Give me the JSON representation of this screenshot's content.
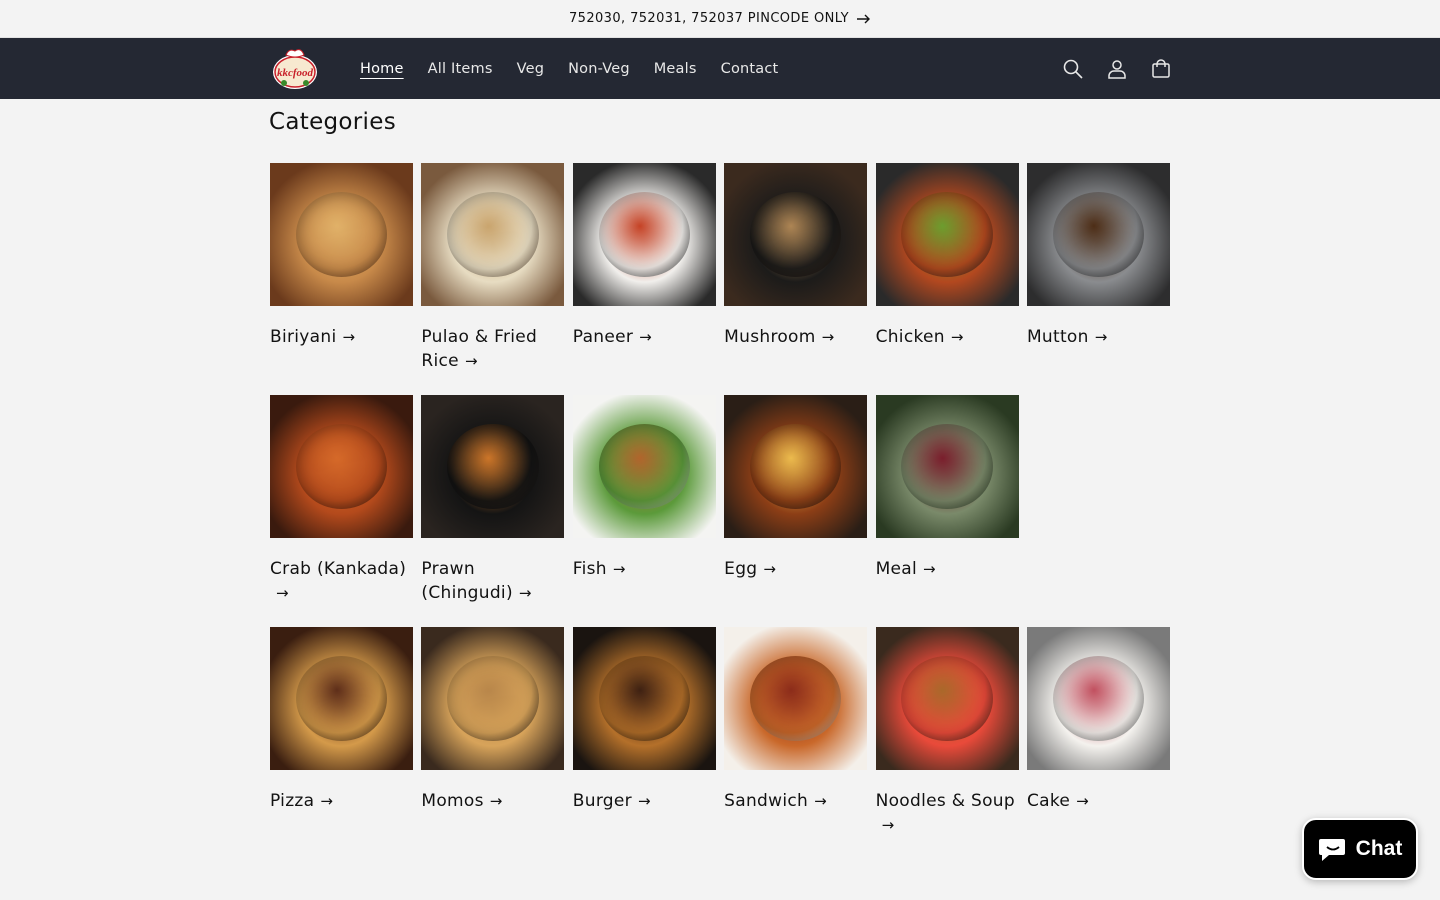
{
  "announcement": {
    "text": "752030, 752031, 752037 PINCODE ONLY"
  },
  "header": {
    "logo_text": "kkcfood",
    "nav": [
      {
        "label": "Home",
        "active": true
      },
      {
        "label": "All Items",
        "active": false
      },
      {
        "label": "Veg",
        "active": false
      },
      {
        "label": "Non-Veg",
        "active": false
      },
      {
        "label": "Meals",
        "active": false
      },
      {
        "label": "Contact",
        "active": false
      }
    ],
    "icons": [
      "search-icon",
      "account-icon",
      "cart-icon"
    ]
  },
  "main": {
    "title": "Categories",
    "arrow": "→",
    "categories": [
      {
        "label": "Biriyani",
        "image": "biriyani-image",
        "colors": [
          "#6b3a1c",
          "#c88a4a",
          "#e2b36a"
        ]
      },
      {
        "label": "Pulao & Fried Rice",
        "image": "pulao-image",
        "colors": [
          "#7a5a3e",
          "#e7dcc2",
          "#c9a36b"
        ]
      },
      {
        "label": "Paneer",
        "image": "paneer-image",
        "colors": [
          "#2a2a2a",
          "#f1efec",
          "#c43c1e"
        ]
      },
      {
        "label": "Mushroom",
        "image": "mushroom-image",
        "colors": [
          "#3b2a1e",
          "#1c1b1a",
          "#b48a57"
        ]
      },
      {
        "label": "Chicken",
        "image": "chicken-image",
        "colors": [
          "#2a2a2a",
          "#b3481f",
          "#6aa12f"
        ]
      },
      {
        "label": "Mutton",
        "image": "mutton-image",
        "colors": [
          "#2d2d2e",
          "#8a8c8f",
          "#4b2a12"
        ]
      },
      {
        "label": "Crab (Kankada)",
        "image": "crab-image",
        "colors": [
          "#3a1a0e",
          "#b44a1c",
          "#d76b2a"
        ]
      },
      {
        "label": "Prawn (Chingudi)",
        "image": "prawn-image",
        "colors": [
          "#2a2420",
          "#141414",
          "#d47a2a"
        ]
      },
      {
        "label": "Fish",
        "image": "fish-image",
        "colors": [
          "#f4f4f2",
          "#5b9a3a",
          "#b5632c"
        ]
      },
      {
        "label": "Egg",
        "image": "egg-image",
        "colors": [
          "#2a1e16",
          "#8c3e16",
          "#f0c050"
        ]
      },
      {
        "label": "Meal",
        "image": "meal-image",
        "colors": [
          "#2a3a22",
          "#7a8a6a",
          "#7a1a2a"
        ]
      },
      {
        "label": "Pizza",
        "image": "pizza-image",
        "colors": [
          "#3a1e10",
          "#d49a4a",
          "#5a2a18"
        ]
      },
      {
        "label": "Momos",
        "image": "momos-image",
        "colors": [
          "#3a2a1e",
          "#d7a35a",
          "#b8864a"
        ]
      },
      {
        "label": "Burger",
        "image": "burger-image",
        "colors": [
          "#1a1410",
          "#b4702a",
          "#3a1e12"
        ]
      },
      {
        "label": "Sandwich",
        "image": "sandwich-image",
        "colors": [
          "#f4f0ea",
          "#c9682a",
          "#8a2a1a"
        ]
      },
      {
        "label": "Noodles & Soup",
        "image": "noodles-soup-image",
        "colors": [
          "#3a2a1e",
          "#e94a3a",
          "#a86a2a"
        ]
      },
      {
        "label": "Cake",
        "image": "cake-image",
        "colors": [
          "#7a7a7a",
          "#f4f2ee",
          "#c04a5a"
        ]
      }
    ]
  },
  "chat": {
    "label": "Chat"
  },
  "colors": {
    "header_bg": "#242833",
    "page_bg": "#f3f3f3",
    "text": "#121212"
  }
}
